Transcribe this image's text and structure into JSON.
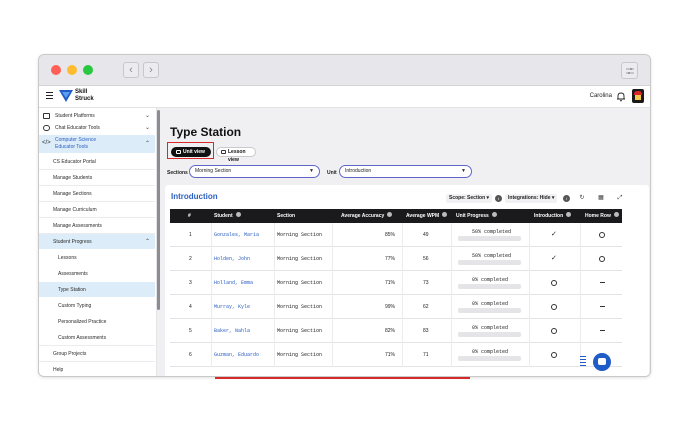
{
  "app": {
    "logo_line1": "Skill",
    "logo_line2": "Struck",
    "user_name": "Carolina"
  },
  "sidebar": {
    "items": [
      {
        "label": "Student Platforms"
      },
      {
        "label": "Chat Educator Tools"
      },
      {
        "label_line1": "Computer Science",
        "label_line2": "Educator Tools"
      },
      {
        "label": "CS Educator Portal"
      },
      {
        "label": "Manage Students"
      },
      {
        "label": "Manage Sections"
      },
      {
        "label": "Manage Curriculum"
      },
      {
        "label": "Manage Assessments"
      },
      {
        "label": "Student Progress"
      },
      {
        "label": "Lessons"
      },
      {
        "label": "Assessments"
      },
      {
        "label": "Type Station"
      },
      {
        "label": "Custom Typing"
      },
      {
        "label": "Personalized Practice"
      },
      {
        "label": "Custom Assessments"
      },
      {
        "label": "Group Projects"
      },
      {
        "label": "Help"
      }
    ]
  },
  "page": {
    "title": "Type Station"
  },
  "views": {
    "unit": "Unit view",
    "lesson": "Lesson view"
  },
  "filters": {
    "sections_label": "Sections",
    "sections_value": "Morning Section",
    "unit_label": "Unit",
    "unit_value": "Introduction"
  },
  "card": {
    "title": "Introduction",
    "scope": "Scope: Section",
    "integrations": "Integrations: Hide"
  },
  "table": {
    "headers": [
      "#",
      "Student",
      "Section",
      "Average Accuracy",
      "Average WPM",
      "Unit Progress",
      "Introduction",
      "Home Row"
    ],
    "rows": [
      {
        "num": "1",
        "student": "Gonzales, Maria",
        "section": "Morning Section",
        "accuracy": "85%",
        "wpm": "49",
        "progress_text": "50% completed",
        "progress": 0.5,
        "intro": "check",
        "home": "circle"
      },
      {
        "num": "2",
        "student": "Holden, John",
        "section": "Morning Section",
        "accuracy": "77%",
        "wpm": "56",
        "progress_text": "50% completed",
        "progress": 0.5,
        "intro": "check",
        "home": "circle"
      },
      {
        "num": "3",
        "student": "Holland, Emma",
        "section": "Morning Section",
        "accuracy": "71%",
        "wpm": "73",
        "progress_text": "0% completed",
        "progress": 0,
        "intro": "circle",
        "home": "dash"
      },
      {
        "num": "4",
        "student": "Murray, Kyle",
        "section": "Morning Section",
        "accuracy": "99%",
        "wpm": "62",
        "progress_text": "0% completed",
        "progress": 0,
        "intro": "circle",
        "home": "dash"
      },
      {
        "num": "5",
        "student": "Baker, Nahla",
        "section": "Morning Section",
        "accuracy": "82%",
        "wpm": "83",
        "progress_text": "0% completed",
        "progress": 0,
        "intro": "circle",
        "home": "dash"
      },
      {
        "num": "6",
        "student": "Guzman, Eduardo",
        "section": "Morning Section",
        "accuracy": "71%",
        "wpm": "71",
        "progress_text": "0% completed",
        "progress": 0,
        "intro": "circle",
        "home": "dash"
      }
    ]
  },
  "colors": {
    "accent": "#2b5fc1",
    "progress": "#2563d9",
    "highlight": "#d62a2a",
    "active_bg": "#dcecf8"
  }
}
